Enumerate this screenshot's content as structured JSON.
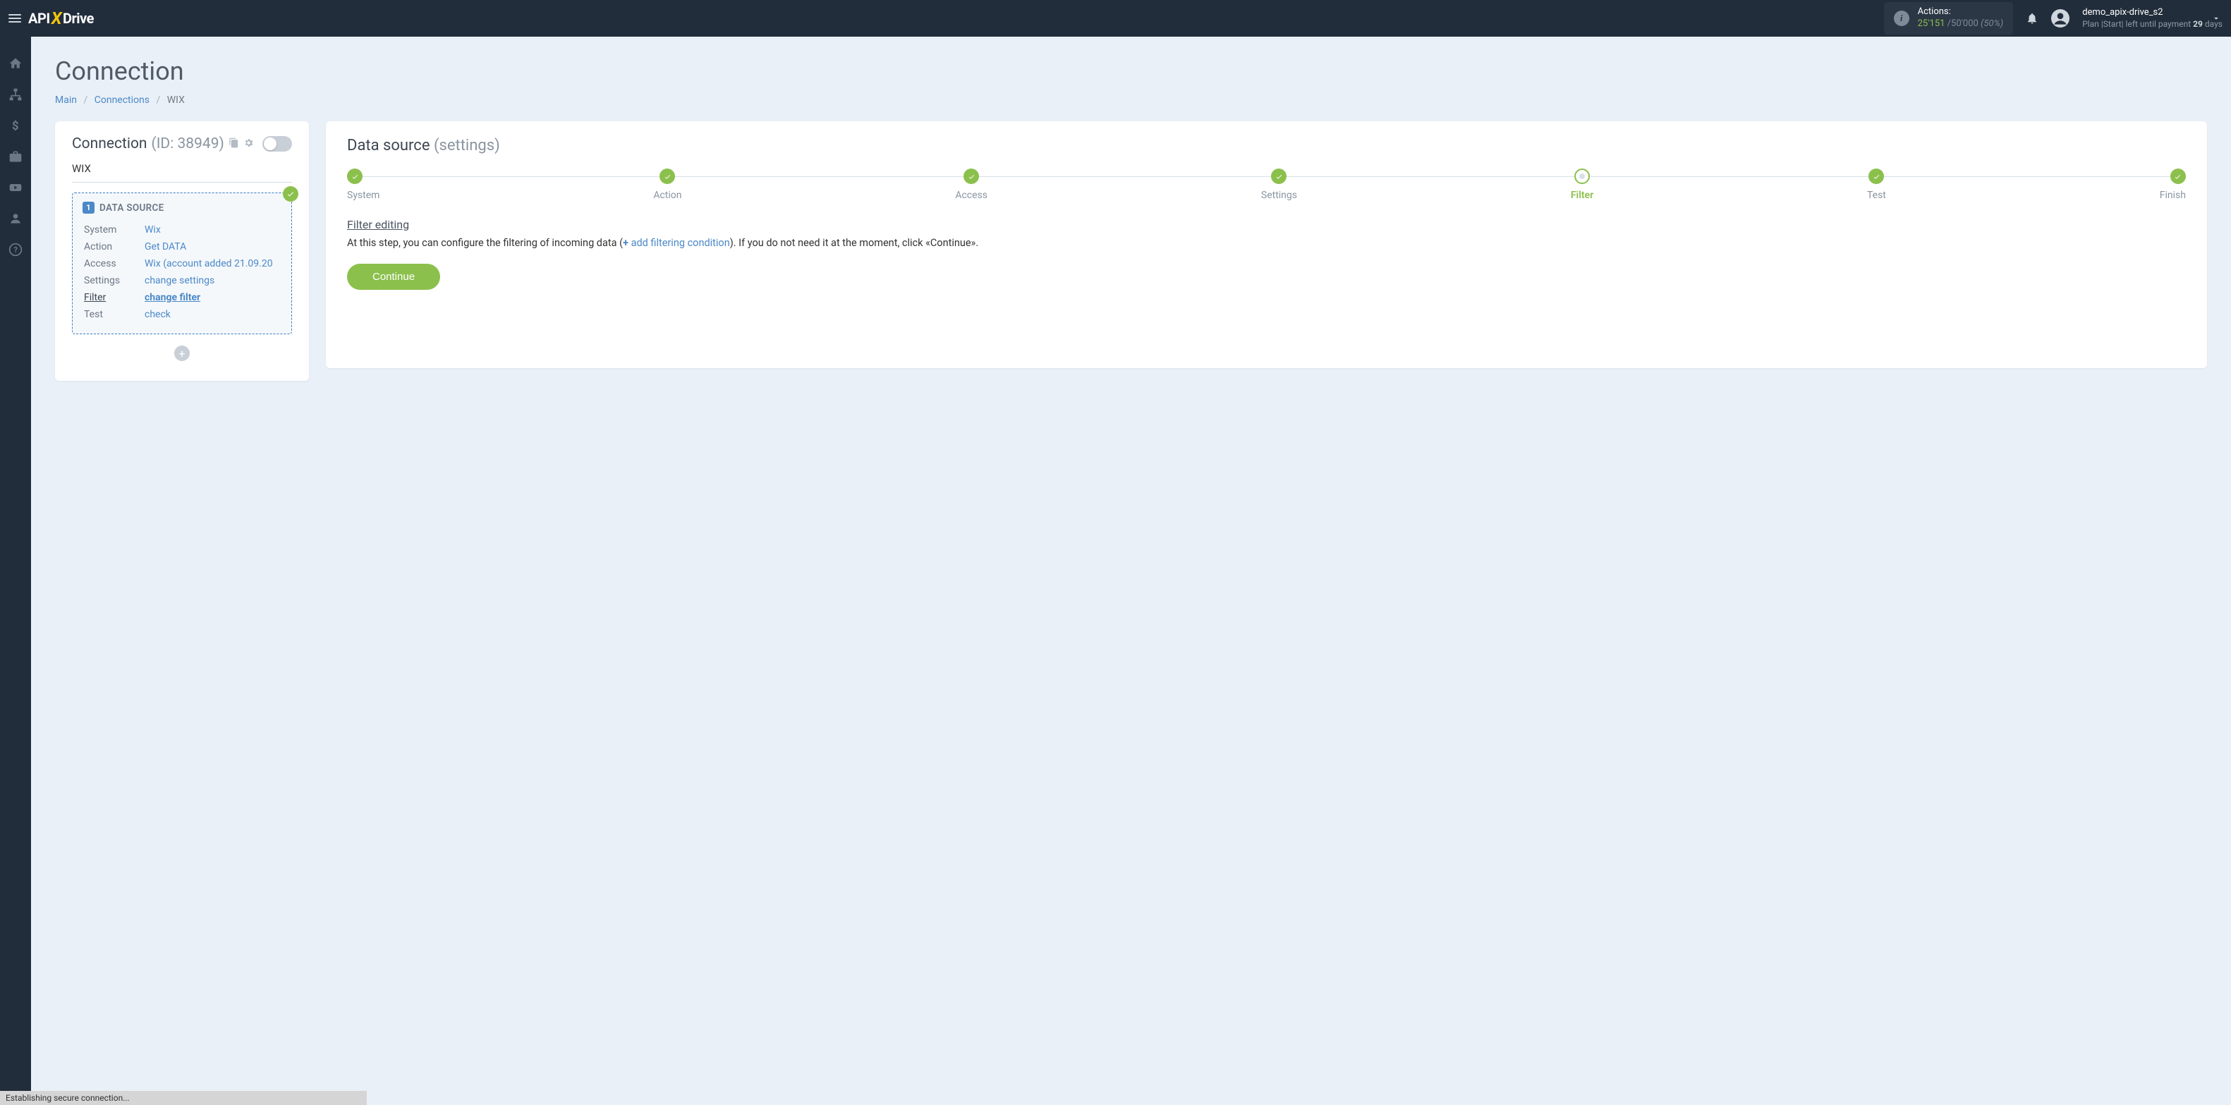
{
  "navbar": {
    "logo_a": "API",
    "logo_x": "X",
    "logo_b": "Drive",
    "actions_label": "Actions:",
    "actions_used": "25'151",
    "actions_sep": " /",
    "actions_limit": "50'000",
    "actions_pct": "(50%)",
    "username": "demo_apix-drive_s2",
    "plan_prefix": "Plan |",
    "plan_name": "Start",
    "plan_mid": "| left until payment ",
    "plan_days": "29",
    "plan_suffix": " days"
  },
  "page": {
    "title": "Connection",
    "bc_main": "Main",
    "bc_conn": "Connections",
    "bc_current": "WIX"
  },
  "left": {
    "title": "Connection ",
    "title_id": "(ID: 38949)",
    "conn_name": "WIX",
    "ds_title": "DATA SOURCE",
    "ds_num": "1",
    "rows": {
      "system_l": "System",
      "system_v": "Wix",
      "action_l": "Action",
      "action_v": "Get DATA",
      "access_l": "Access",
      "access_v": "Wix (account added 21.09.20",
      "settings_l": "Settings",
      "settings_v": "change settings",
      "filter_l": "Filter",
      "filter_v": "change filter",
      "test_l": "Test",
      "test_v": "check"
    }
  },
  "right": {
    "h_main": "Data source ",
    "h_sub": "(settings)",
    "steps": [
      {
        "label": "System",
        "state": "done"
      },
      {
        "label": "Action",
        "state": "done"
      },
      {
        "label": "Access",
        "state": "done"
      },
      {
        "label": "Settings",
        "state": "done"
      },
      {
        "label": "Filter",
        "state": "current"
      },
      {
        "label": "Test",
        "state": "done"
      },
      {
        "label": "Finish",
        "state": "done"
      }
    ],
    "section_title": "Filter editing",
    "desc_a": "At this step, you can configure the filtering of incoming data (",
    "add_filter": " add filtering condition",
    "desc_b": "). If you do not need it at the moment, click «Continue».",
    "continue": "Continue"
  },
  "status": "Establishing secure connection..."
}
